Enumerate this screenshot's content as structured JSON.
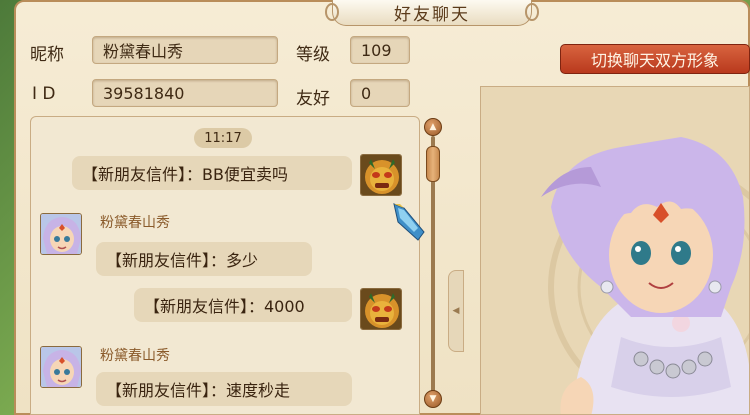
{
  "window": {
    "title": "好友聊天"
  },
  "profile": {
    "nickname_label": "昵称",
    "nickname_value": "粉黛春山秀",
    "level_label": "等级",
    "level_value": "109",
    "id_label": "I D",
    "id_value": "39581840",
    "friendship_label": "友好",
    "friendship_value": "0"
  },
  "toolbar": {
    "switch_label": "切换聊天双方形象"
  },
  "chat": {
    "timestamp": "11:17",
    "messages": [
      {
        "sender": "self",
        "text": "【新朋友信件】：BB便宜卖吗"
      },
      {
        "sender": "friend",
        "name": "粉黛春山秀",
        "text": "【新朋友信件】：多少"
      },
      {
        "sender": "self",
        "text": "【新朋友信件】：4000"
      },
      {
        "sender": "friend",
        "name": "粉黛春山秀",
        "text": "【新朋友信件】：速度秒走"
      }
    ]
  },
  "icons": {
    "scroll_up": "triangle-up",
    "scroll_down": "triangle-down",
    "collapse": "triangle-left",
    "self_avatar": "lion-mask-avatar",
    "friend_avatar": "lavender-hair-girl-avatar",
    "item": "blue-gem-icon"
  },
  "colors": {
    "button": "#c04a26",
    "panel": "#f2e8d2",
    "border": "#b98d5a",
    "name": "#8a5a2a"
  }
}
